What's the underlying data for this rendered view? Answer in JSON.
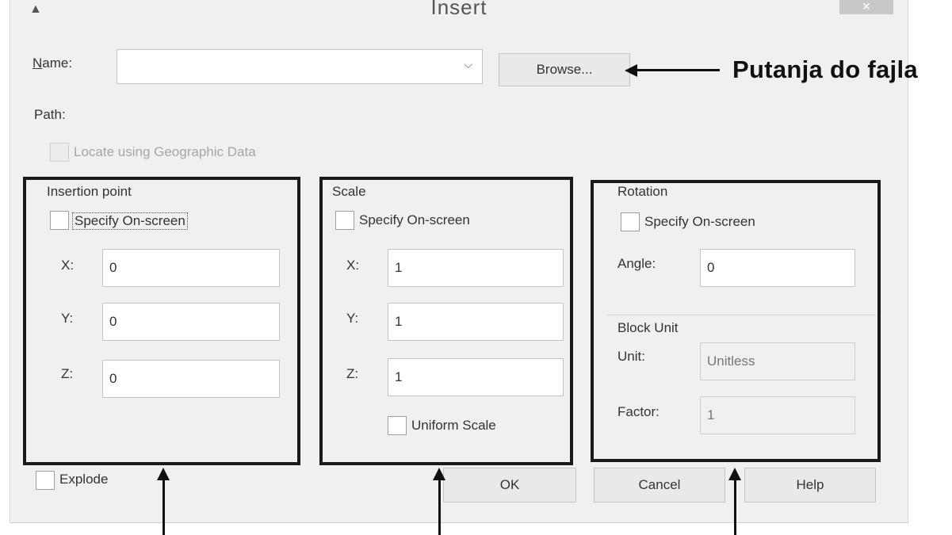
{
  "window": {
    "title": "Insert",
    "close_glyph": "✕"
  },
  "name_row": {
    "label": "Name:",
    "value": "",
    "browse_label": "Browse..."
  },
  "path_label": "Path:",
  "geo_checkbox": {
    "label": "Locate using Geographic Data",
    "checked": false,
    "enabled": false
  },
  "insertion_point": {
    "title": "Insertion point",
    "specify_label": "Specify On-screen",
    "x_label": "X:",
    "x_value": "0",
    "y_label": "Y:",
    "y_value": "0",
    "z_label": "Z:",
    "z_value": "0"
  },
  "scale": {
    "title": "Scale",
    "specify_label": "Specify On-screen",
    "x_label": "X:",
    "x_value": "1",
    "y_label": "Y:",
    "y_value": "1",
    "z_label": "Z:",
    "z_value": "1",
    "uniform_label": "Uniform Scale"
  },
  "rotation": {
    "title": "Rotation",
    "specify_label": "Specify On-screen",
    "angle_label": "Angle:",
    "angle_value": "0"
  },
  "block_unit": {
    "title": "Block Unit",
    "unit_label": "Unit:",
    "unit_value": "Unitless",
    "factor_label": "Factor:",
    "factor_value": "1"
  },
  "explode_label": "Explode",
  "buttons": {
    "ok": "OK",
    "cancel": "Cancel",
    "help": "Help"
  },
  "annotation": {
    "note": "Putanja do fajla"
  },
  "colors": {
    "frame": "#1a1a1a",
    "dialog_bg": "#f0f0f0"
  }
}
